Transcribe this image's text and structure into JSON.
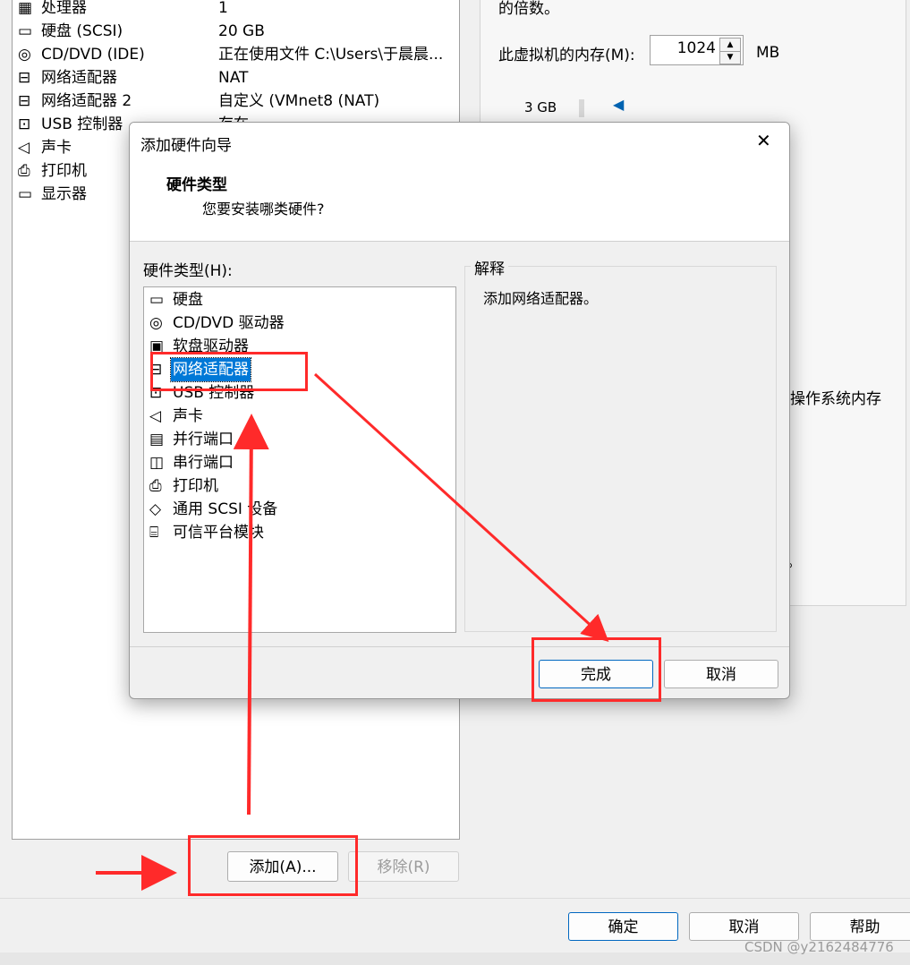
{
  "devices": [
    {
      "name": "处理器",
      "summary": "1",
      "icon": "cpu-icon"
    },
    {
      "name": "硬盘 (SCSI)",
      "summary": "20 GB",
      "icon": "hard-disk-icon"
    },
    {
      "name": "CD/DVD (IDE)",
      "summary": "正在使用文件 C:\\Users\\于晨晨...",
      "icon": "cd-dvd-icon"
    },
    {
      "name": "网络适配器",
      "summary": "NAT",
      "icon": "network-adapter-icon"
    },
    {
      "name": "网络适配器 2",
      "summary": "自定义 (VMnet8 (NAT)",
      "icon": "network-adapter-icon"
    },
    {
      "name": "USB 控制器",
      "summary": "存在",
      "icon": "usb-icon"
    },
    {
      "name": "声卡",
      "summary": "",
      "icon": "sound-icon"
    },
    {
      "name": "打印机",
      "summary": "",
      "icon": "printer-icon"
    },
    {
      "name": "显示器",
      "summary": "",
      "icon": "display-icon"
    }
  ],
  "right": {
    "multiple_text": "的倍数。",
    "memory_label": "此虚拟机的内存(M):",
    "memory_value": "1024",
    "memory_unit": "MB",
    "slider_tick": "3 GB",
    "os_memory_fragment": "操作系统内存",
    "dot_fragment": "。"
  },
  "main_buttons": {
    "add": "添加(A)...",
    "remove": "移除(R)",
    "ok": "确定",
    "cancel": "取消",
    "help": "帮助"
  },
  "dialog": {
    "title": "添加硬件向导",
    "close_glyph": "✕",
    "heading": "硬件类型",
    "subheading": "您要安装哪类硬件?",
    "list_label": "硬件类型(H):",
    "hardware_types": [
      {
        "label": "硬盘",
        "icon": "hard-disk-icon"
      },
      {
        "label": "CD/DVD 驱动器",
        "icon": "cd-dvd-icon"
      },
      {
        "label": "软盘驱动器",
        "icon": "floppy-icon"
      },
      {
        "label": "网络适配器",
        "icon": "network-adapter-icon",
        "selected": true
      },
      {
        "label": "USB 控制器",
        "icon": "usb-icon"
      },
      {
        "label": "声卡",
        "icon": "sound-icon"
      },
      {
        "label": "并行端口",
        "icon": "parallel-port-icon"
      },
      {
        "label": "串行端口",
        "icon": "serial-port-icon"
      },
      {
        "label": "打印机",
        "icon": "printer-icon"
      },
      {
        "label": "通用 SCSI 设备",
        "icon": "scsi-icon"
      },
      {
        "label": "可信平台模块",
        "icon": "tpm-icon"
      }
    ],
    "explain_title": "解释",
    "explain_text": "添加网络适配器。",
    "finish": "完成",
    "cancel": "取消"
  },
  "watermark": "CSDN @y2162484776",
  "colors": {
    "annotation": "#ff2a2a",
    "selection": "#0078d7",
    "primary_border": "#0067c0"
  }
}
